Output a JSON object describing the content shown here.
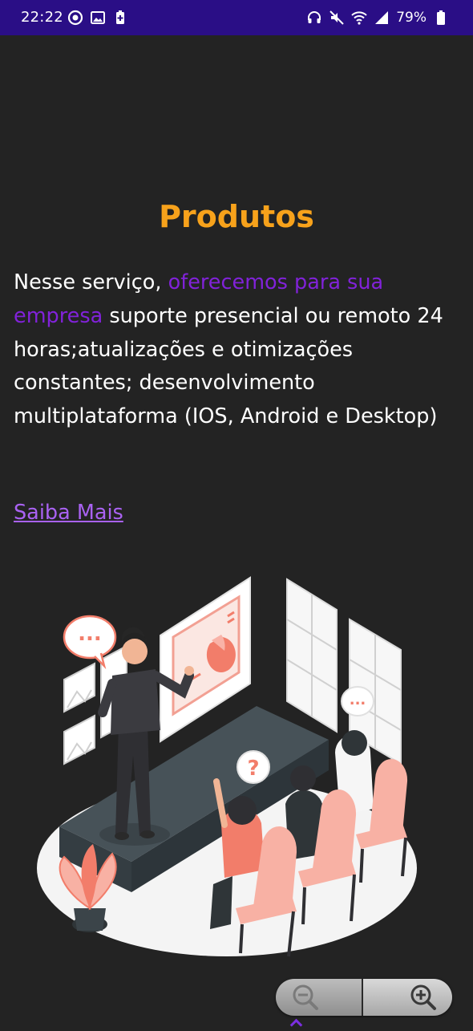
{
  "status_bar": {
    "time": "22:22",
    "battery_percent": "79%",
    "left_icons": [
      "record-icon",
      "image-icon",
      "battery-saver-icon"
    ],
    "right_icons": [
      "headset-icon",
      "mute-icon",
      "wifi-icon",
      "signal-icon",
      "battery-icon"
    ],
    "background_color": "#2a0e86"
  },
  "content": {
    "title": "Produtos",
    "paragraph": {
      "before": "Nesse serviço, ",
      "highlight": "oferecemos para sua empresa",
      "after": " suporte presencial ou remoto 24 horas;atualizações e otimizações constantes; desenvolvimento multiplataforma (IOS, Android e Desktop)"
    },
    "link_label": "Saiba Mais",
    "title_color": "#f7a21b",
    "highlight_color": "#8122d9",
    "link_color": "#a962f2"
  },
  "illustration": {
    "name": "presentation-meeting-illustration",
    "speech_bubble_left": "...",
    "speech_bubble_right": "...",
    "question_mark": "?"
  },
  "zoom_control": {
    "icons": [
      "zoom-out-icon",
      "zoom-in-icon"
    ]
  }
}
